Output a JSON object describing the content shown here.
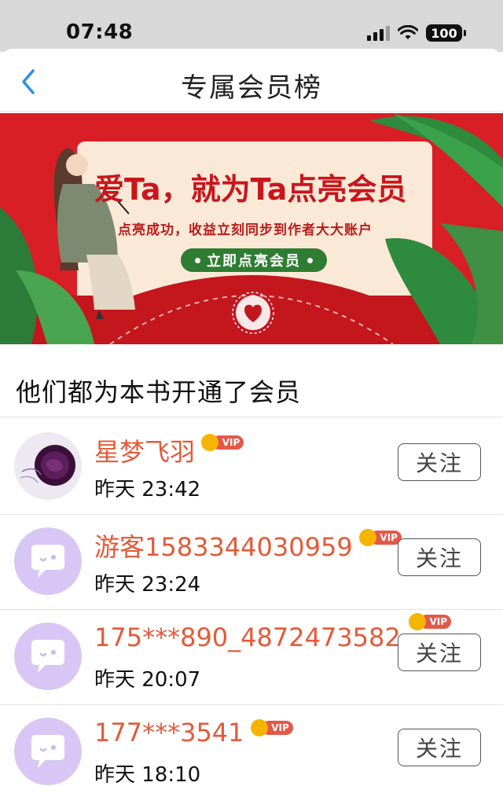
{
  "status_bar": {
    "time": "07:48",
    "battery": "100"
  },
  "nav": {
    "title": "专属会员榜"
  },
  "banner": {
    "headline": "爱Ta，就为Ta点亮会员",
    "subtext": "点亮成功，收益立刻同步到作者大大账户",
    "button_label": "立即点亮会员"
  },
  "section_title": "他们都为本书开通了会员",
  "vip_label": "VIP",
  "follow_label": "关注",
  "members": [
    {
      "name": "星梦飞羽",
      "time": "昨天 23:42",
      "avatar": "rose-photo"
    },
    {
      "name": "游客1583344030959",
      "time": "昨天 23:24",
      "avatar": "default-chat-bubble"
    },
    {
      "name": "175***890_4872473582",
      "time": "昨天 20:07",
      "avatar": "default-chat-bubble"
    },
    {
      "name": "177***3541",
      "time": "昨天 18:10",
      "avatar": "default-chat-bubble"
    }
  ],
  "colors": {
    "accent": "#e45a39",
    "banner_red": "#d81f26",
    "banner_card": "#fbe9d7",
    "button_green": "#2e7d32",
    "avatar_default": "#d8c7f4"
  }
}
